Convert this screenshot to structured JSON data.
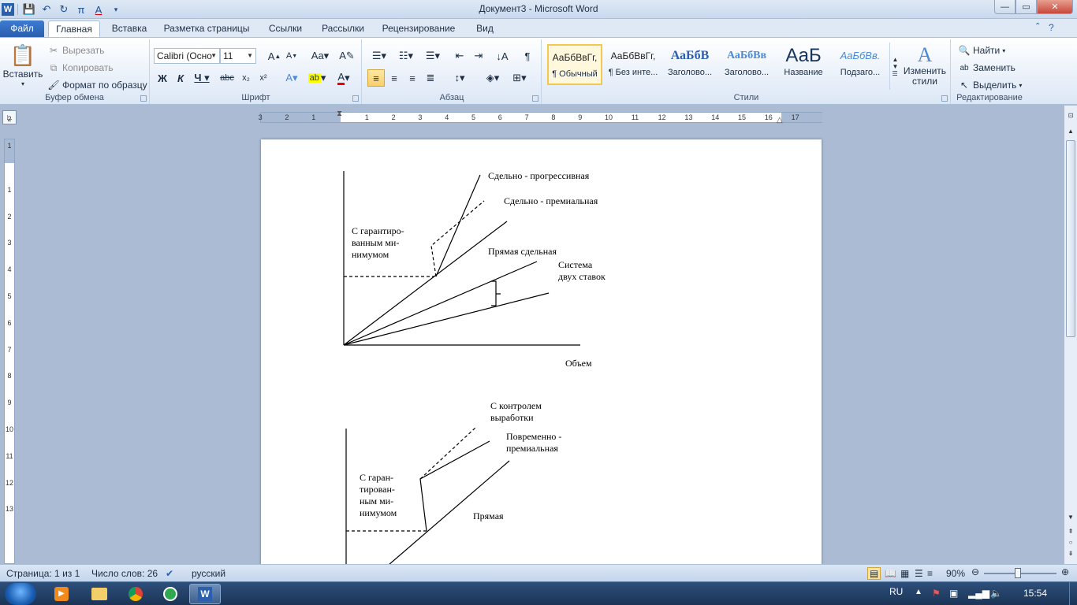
{
  "window": {
    "title": "Документ3  -  Microsoft Word"
  },
  "tabs": [
    {
      "label": "Файл"
    },
    {
      "label": "Главная"
    },
    {
      "label": "Вставка"
    },
    {
      "label": "Разметка страницы"
    },
    {
      "label": "Ссылки"
    },
    {
      "label": "Рассылки"
    },
    {
      "label": "Рецензирование"
    },
    {
      "label": "Вид"
    }
  ],
  "clipboard": {
    "paste": "Вставить",
    "cut": "Вырезать",
    "copy": "Копировать",
    "format_painter": "Формат по образцу",
    "label": "Буфер обмена"
  },
  "font": {
    "name": "Calibri (Осно",
    "size": "11",
    "label": "Шрифт"
  },
  "paragraph": {
    "label": "Абзац"
  },
  "styles": {
    "items": [
      {
        "sample": "АаБбВвГг,",
        "name": "¶ Обычный"
      },
      {
        "sample": "АаБбВвГг,",
        "name": "¶ Без инте..."
      },
      {
        "sample": "АаБбВ",
        "name": "Заголово..."
      },
      {
        "sample": "АаБбВв",
        "name": "Заголово..."
      },
      {
        "sample": "АаБ",
        "name": "Название"
      },
      {
        "sample": "АаБбВв.",
        "name": "Подзаго..."
      }
    ],
    "change": "Изменить стили",
    "label": "Стили"
  },
  "editing": {
    "find": "Найти",
    "replace": "Заменить",
    "select": "Выделить",
    "label": "Редактирование"
  },
  "hruler_numbers": [
    "3",
    "2",
    "1",
    "1",
    "2",
    "3",
    "4",
    "5",
    "6",
    "7",
    "8",
    "9",
    "10",
    "11",
    "12",
    "13",
    "14",
    "15",
    "16",
    "17"
  ],
  "vruler_numbers": [
    "2",
    "1",
    "1",
    "2",
    "3",
    "4",
    "5",
    "6",
    "7",
    "8",
    "9",
    "10",
    "11",
    "12",
    "13"
  ],
  "document": {
    "chart1_labels": {
      "progressive": "Сдельно - прогрессивная",
      "premium": "Сдельно - премиальная",
      "guaranteed": "С гарантиро-\nванным ми-\nнимумом",
      "direct": "Прямая сдельная",
      "two_rate": "Система\nдвух ставок",
      "volume": "Объем"
    },
    "chart2_labels": {
      "output_control": "С контролем\nвыработки",
      "time_premium": "Повременно -\nпремиальная",
      "guaranteed": "С гаран-\nтирован-\nным ми-\nнимумом",
      "direct": "Прямая"
    }
  },
  "status": {
    "page": "Страница: 1 из 1",
    "words": "Число слов: 26",
    "language": "русский",
    "zoom": "90%"
  },
  "taskbar": {
    "lang": "RU",
    "time": "15:54"
  }
}
